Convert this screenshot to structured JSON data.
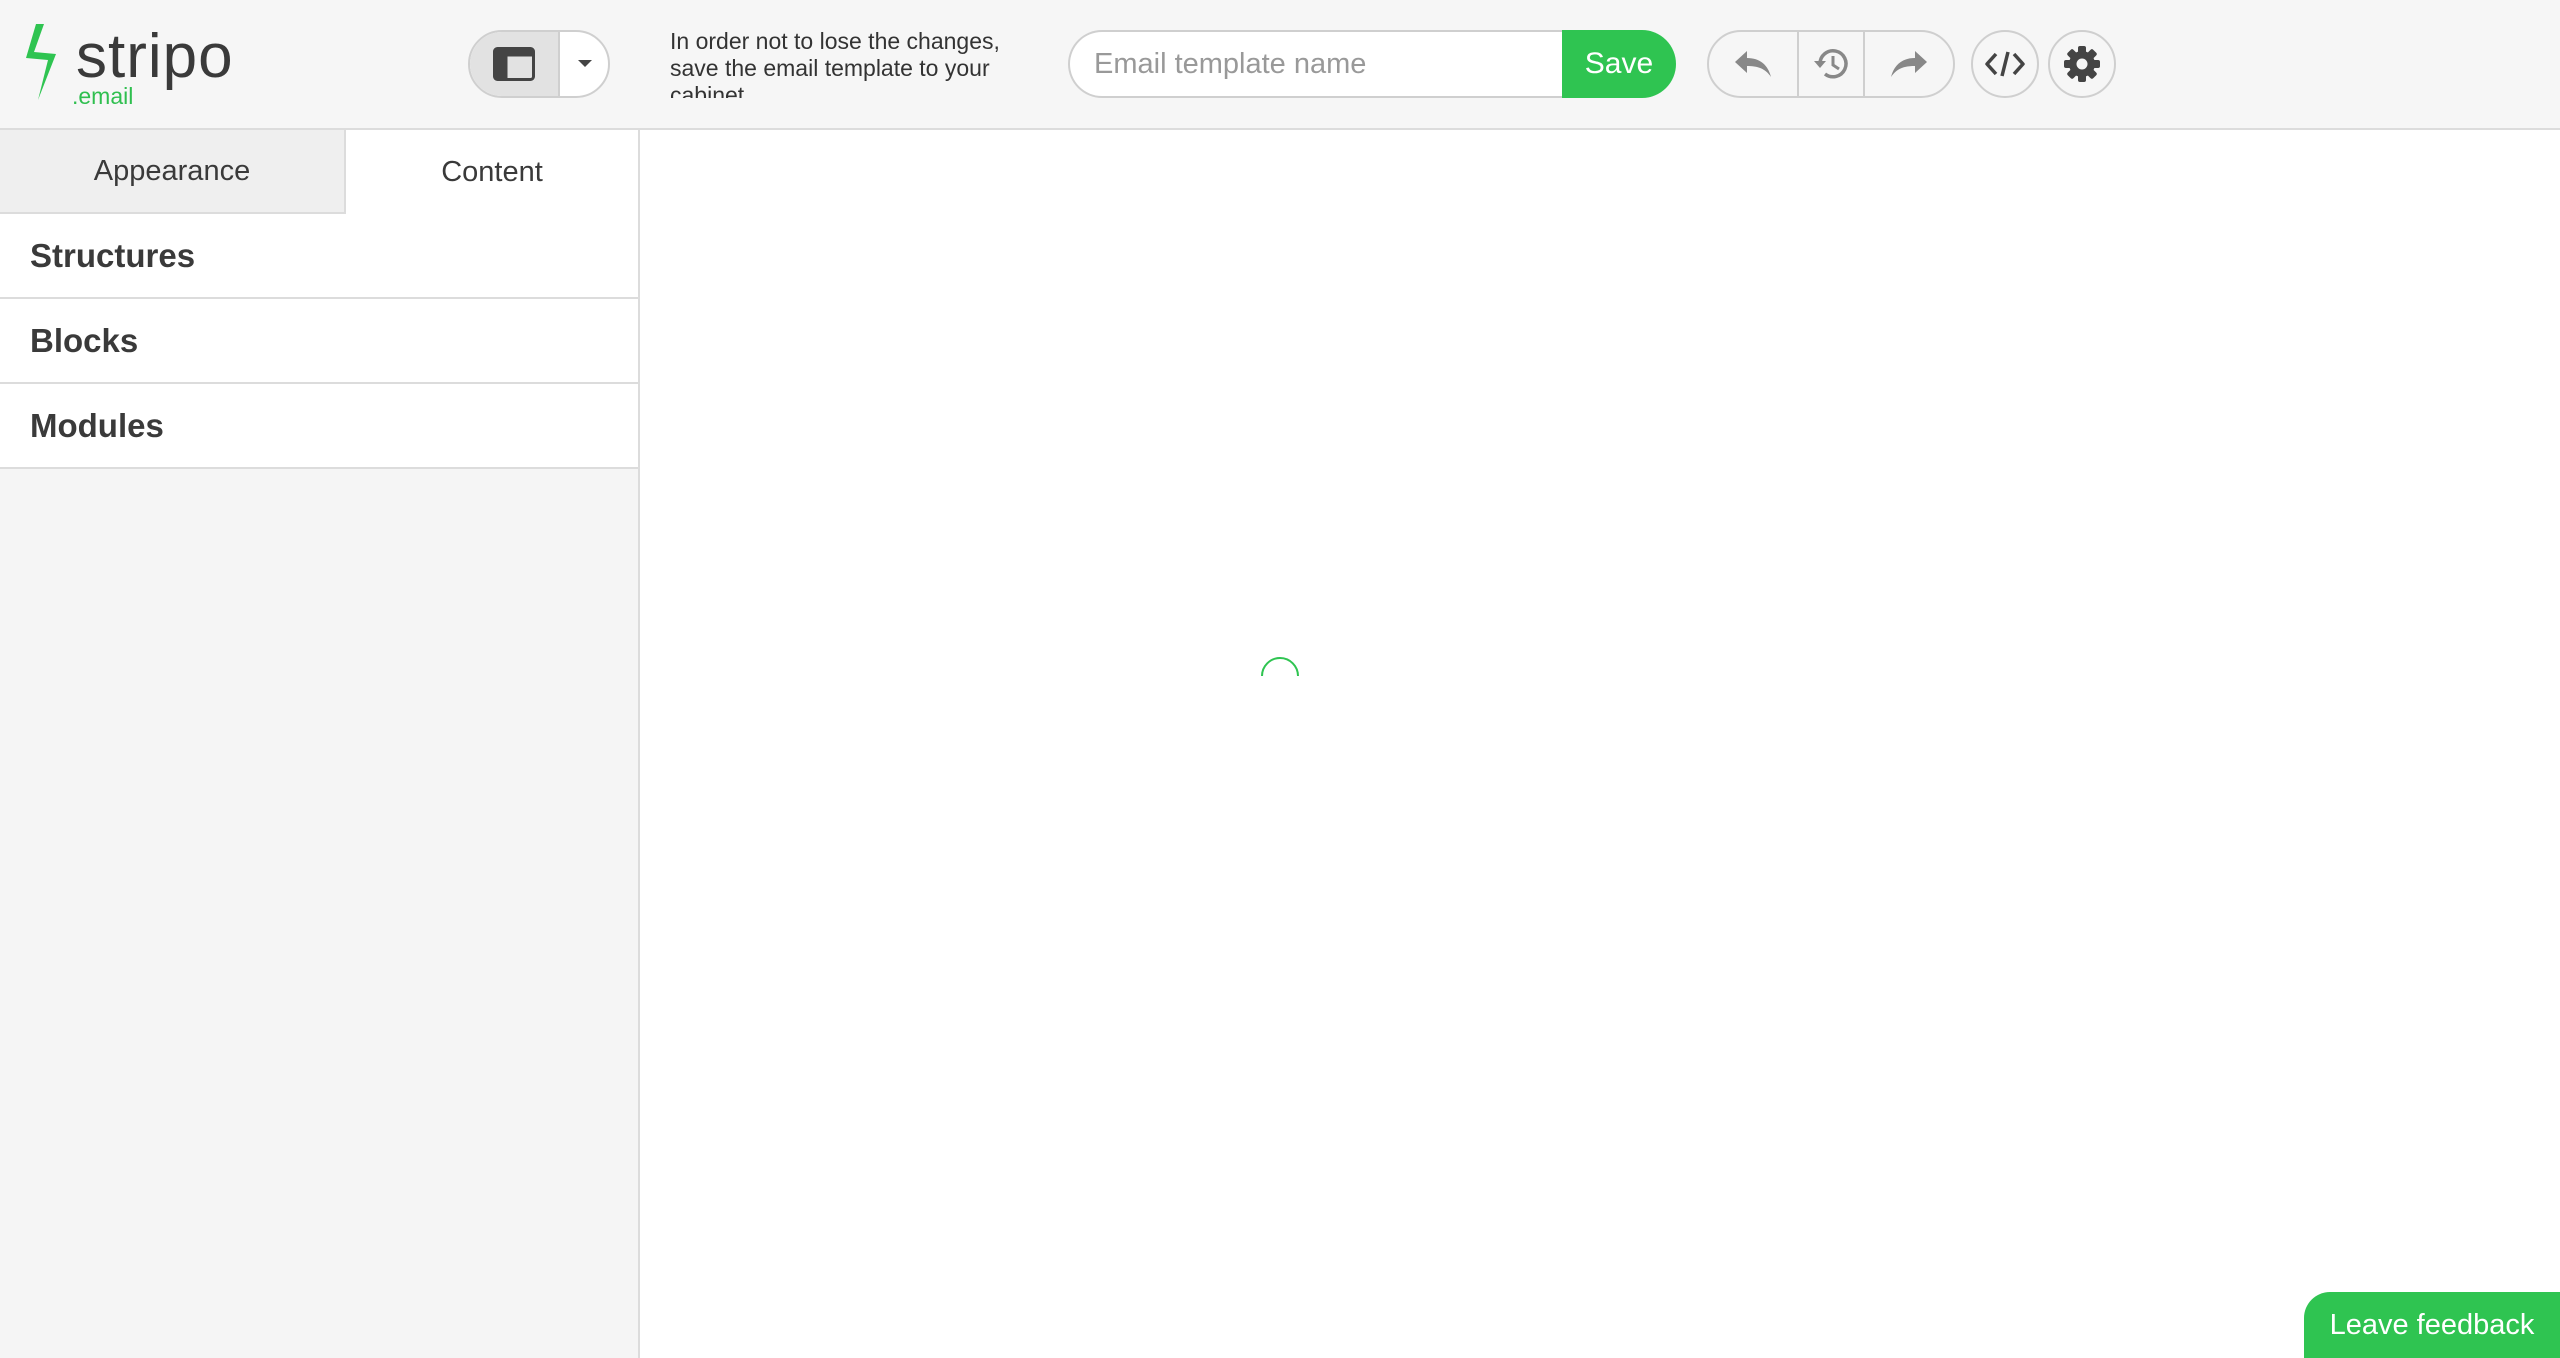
{
  "logo": {
    "word": "stripo",
    "sub": ".email"
  },
  "notice": {
    "text": "In order not to lose the changes, save the email template to your cabinet"
  },
  "template_name": {
    "placeholder": "Email template name",
    "value": ""
  },
  "toolbar": {
    "save_label": "Save"
  },
  "tabs": [
    {
      "label": "Appearance",
      "active": false
    },
    {
      "label": "Content",
      "active": true
    }
  ],
  "sections": [
    {
      "label": "Structures"
    },
    {
      "label": "Blocks"
    },
    {
      "label": "Modules"
    }
  ],
  "feedback": {
    "label": "Leave feedback"
  },
  "colors": {
    "brand_green": "#2fc451",
    "logo_text": "#3a3a3a",
    "border": "#cfcfcf"
  },
  "icons": [
    "layout-view-icon",
    "caret-down-icon",
    "undo-icon",
    "history-icon",
    "redo-icon",
    "code-icon",
    "gear-icon",
    "loading-spinner-icon"
  ]
}
